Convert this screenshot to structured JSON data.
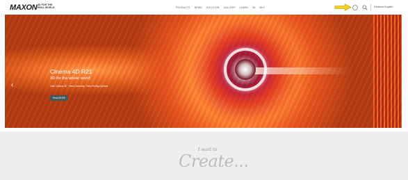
{
  "header": {
    "logo": "MAXON",
    "tagline_line1": "3D FOR THE",
    "tagline_line2": "REAL WORLD",
    "nav": [
      "PRODUCTS",
      "NEWS",
      "SOLUTION",
      "GALLERY",
      "LEARN",
      "3D",
      "BUY"
    ],
    "language": "Deutsch English"
  },
  "hero": {
    "title": "Cinema 4D R21",
    "subtitle": "3D for the whole world",
    "small_text": "One Cinema 4D · New Licensing · New Pricing Options",
    "button_label": "Read MORE"
  },
  "section": {
    "lead": "I want to",
    "headline": "Create..."
  },
  "colors": {
    "arrow": "#f2d21c",
    "button": "#3e5a5a"
  }
}
